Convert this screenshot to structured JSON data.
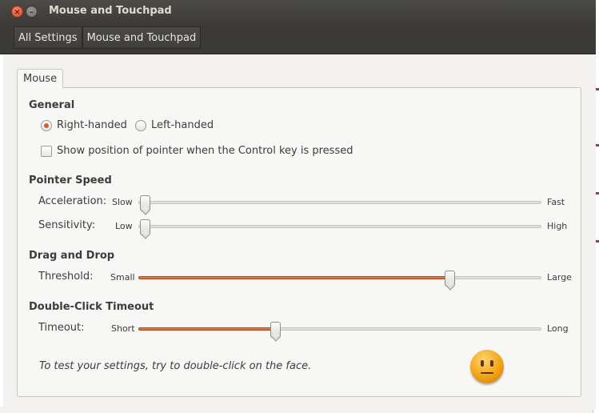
{
  "window": {
    "title": "Mouse and Touchpad",
    "close_glyph": "×",
    "minimize_glyph": "–"
  },
  "breadcrumb": {
    "items": [
      "All Settings",
      "Mouse and Touchpad"
    ]
  },
  "tabs": [
    {
      "label": "Mouse"
    }
  ],
  "general": {
    "title": "General",
    "right_handed": {
      "label": "Right-handed",
      "checked": true
    },
    "left_handed": {
      "label": "Left-handed",
      "checked": false
    },
    "show_pointer": {
      "label": "Show position of pointer when the Control key is pressed",
      "checked": false
    }
  },
  "pointer_speed": {
    "title": "Pointer Speed",
    "acceleration": {
      "label": "Acceleration:",
      "min": "Slow",
      "max": "Fast",
      "value": 0.0
    },
    "sensitivity": {
      "label": "Sensitivity:",
      "min": "Low",
      "max": "High",
      "value": 0.0
    }
  },
  "drag_drop": {
    "title": "Drag and Drop",
    "threshold": {
      "label": "Threshold:",
      "min": "Small",
      "max": "Large",
      "value": 0.77
    }
  },
  "double_click": {
    "title": "Double-Click Timeout",
    "timeout": {
      "label": "Timeout:",
      "min": "Short",
      "max": "Long",
      "value": 0.34
    }
  },
  "hint": "To test your settings, try to double-click on the face.",
  "colors": {
    "accent": "#e05a2c",
    "titlebar": "#3c3b37",
    "background": "#f2f1f0"
  }
}
